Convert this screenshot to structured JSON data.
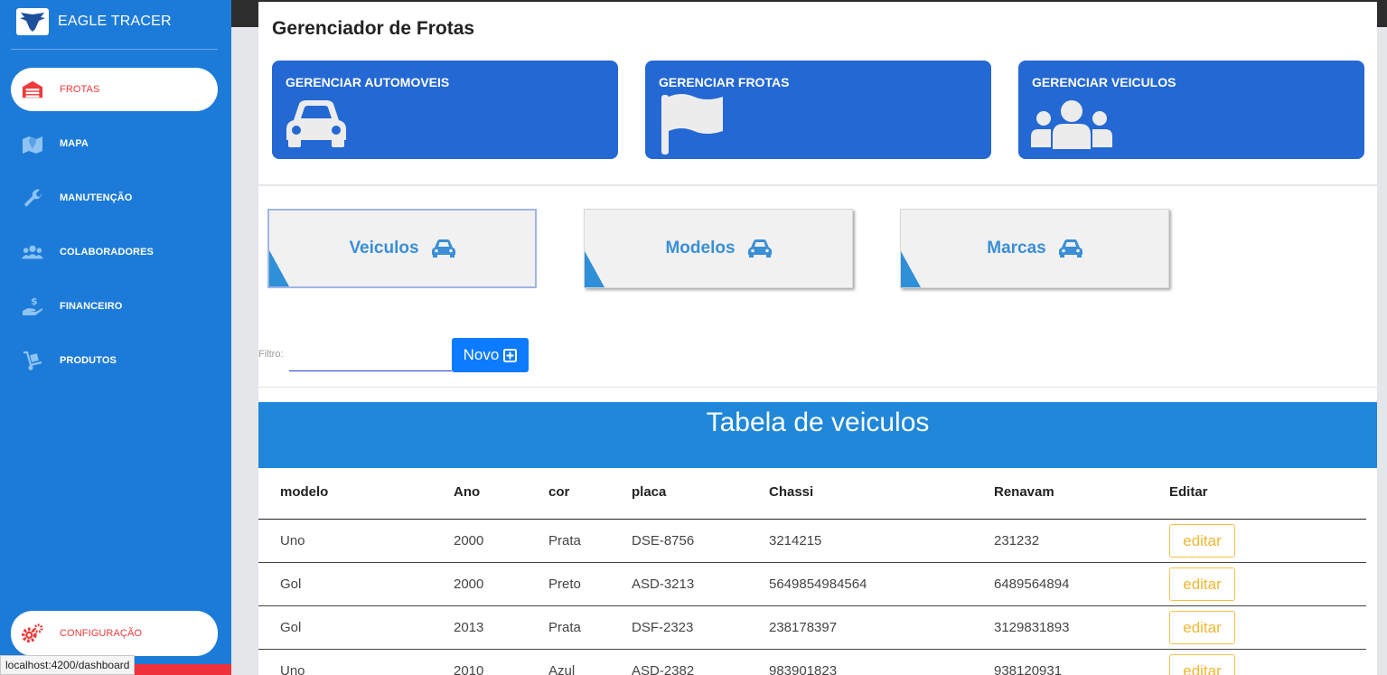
{
  "sidebar": {
    "brand": "EAGLE TRACER",
    "items": [
      {
        "label": "FROTAS",
        "icon": "garage-icon",
        "active": true
      },
      {
        "label": "MAPA",
        "icon": "map-icon",
        "active": false
      },
      {
        "label": "MANUTENÇÃO",
        "icon": "wrench-icon",
        "active": false
      },
      {
        "label": "COLABORADORES",
        "icon": "users-icon",
        "active": false
      },
      {
        "label": "FINANCEIRO",
        "icon": "hand-dollar-icon",
        "active": false
      },
      {
        "label": "PRODUTOS",
        "icon": "dolly-icon",
        "active": false
      }
    ],
    "settings": {
      "label": "CONFIGURAÇÃO",
      "icon": "cogs-icon"
    }
  },
  "status_bar": {
    "url": "localhost:4200/dashboard"
  },
  "page": {
    "title": "Gerenciador de Frotas"
  },
  "manage_cards": [
    {
      "title": "GERENCIAR AUTOMOVEIS",
      "icon": "car-icon"
    },
    {
      "title": "GERENCIAR FROTAS",
      "icon": "flag-icon"
    },
    {
      "title": "GERENCIAR VEICULOS",
      "icon": "users-icon"
    }
  ],
  "tabs": [
    {
      "label": "Veiculos",
      "icon": "car-icon",
      "selected": true
    },
    {
      "label": "Modelos",
      "icon": "car-icon",
      "selected": false
    },
    {
      "label": "Marcas",
      "icon": "car-icon",
      "selected": false
    }
  ],
  "filter": {
    "label": "Filtro:",
    "value": "",
    "placeholder": ""
  },
  "new_button": {
    "label": "Novo",
    "icon": "plus-square-icon"
  },
  "table": {
    "title": "Tabela de veiculos",
    "columns": [
      "modelo",
      "Ano",
      "cor",
      "placa",
      "Chassi",
      "Renavam",
      "Editar"
    ],
    "edit_label": "editar",
    "rows": [
      [
        "Uno",
        "2000",
        "Prata",
        "DSE-8756",
        "3214215",
        "231232"
      ],
      [
        "Gol",
        "2000",
        "Preto",
        "ASD-3213",
        "5649854984564",
        "6489564894"
      ],
      [
        "Gol",
        "2013",
        "Prata",
        "DSF-2323",
        "238178397",
        "3129831893"
      ],
      [
        "Uno",
        "2010",
        "Azul",
        "ASD-2382",
        "983901823",
        "938120931"
      ]
    ]
  },
  "colors": {
    "sidebar": "#1c7bd8",
    "active_text": "#ee3a3a",
    "card_blue": "#2468d3",
    "tab_text": "#3a8fd6",
    "table_band": "#2087d9",
    "edit_border": "#f3c24a",
    "novo_button": "#0d7bff"
  }
}
